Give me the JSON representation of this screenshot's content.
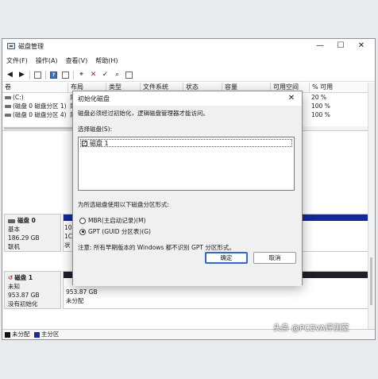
{
  "window": {
    "title": "磁盘管理",
    "minimize": "—",
    "maximize": "☐",
    "close": "✕"
  },
  "menu": [
    "文件(F)",
    "操作(A)",
    "查看(V)",
    "帮助(H)"
  ],
  "volume_table": {
    "headers": [
      "卷",
      "布局",
      "类型",
      "文件系统",
      "状态",
      "容量",
      "可用空间",
      "% 可用"
    ],
    "rows": [
      {
        "name": "(C:)",
        "layout": "简",
        "free_pct": "20 %"
      },
      {
        "name": "(磁盘 0 磁盘分区 1)",
        "layout": "简",
        "free_pct": "100 %"
      },
      {
        "name": "(磁盘 0 磁盘分区 4)",
        "layout": "简",
        "free_pct": "100 %"
      }
    ]
  },
  "disks": [
    {
      "name": "磁盘 0",
      "type": "基本",
      "size": "186.29 GB",
      "status": "联机",
      "part_text_1": "10",
      "part_text_2": "1C",
      "part_text_3": "状"
    },
    {
      "name": "磁盘 1",
      "type": "未知",
      "size": "953.87 GB",
      "status": "没有初始化",
      "part_size": "953.87 GB",
      "part_status": "未分配"
    }
  ],
  "legend": [
    {
      "label": "未分配",
      "color": "#111111"
    },
    {
      "label": "主分区",
      "color": "#1c2a9c"
    }
  ],
  "dialog": {
    "title": "初始化磁盘",
    "close": "✕",
    "intro": "磁盘必须经过初始化，逻辑磁盘管理器才能访问。",
    "select_label": "选择磁盘(S):",
    "disks": [
      {
        "label": "磁盘 1",
        "checked": "✓"
      }
    ],
    "partition_style_label": "为所选磁盘使用以下磁盘分区形式:",
    "options": [
      {
        "label": "MBR(主启动记录)(M)",
        "selected": false
      },
      {
        "label": "GPT (GUID 分区表)(G)",
        "selected": true
      }
    ],
    "note": "注意: 所有早期版本的 Windows 都不识别 GPT 分区形式。",
    "ok_label": "确定",
    "cancel_label": "取消"
  },
  "watermark": "头条 @PCEVA评测室"
}
